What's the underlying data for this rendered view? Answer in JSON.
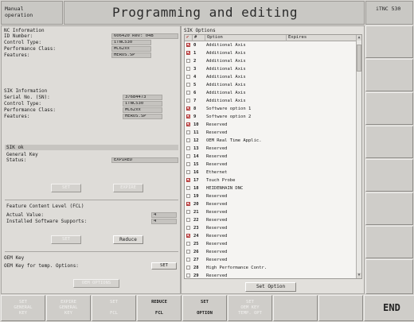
{
  "header": {
    "mode_line1": "Manual",
    "mode_line2": "operation",
    "title": "Programming and editing",
    "brand": "iTNC 530"
  },
  "nc_info": {
    "section_title": "NC Information",
    "rows": [
      {
        "label": "ID Number:",
        "value": "606420 Rev: 04B"
      },
      {
        "label": "Control Type:",
        "value": "iTNC530"
      },
      {
        "label": "Performance Class:",
        "value": "MC62xx"
      },
      {
        "label": "Features:",
        "value": "HEROS.SP"
      }
    ]
  },
  "sik_info": {
    "section_title": "SIK Information",
    "rows": [
      {
        "label": "Serial No. (SN):",
        "value": "37684473"
      },
      {
        "label": "Control Type:",
        "value": "iTNC530"
      },
      {
        "label": "Performance Class:",
        "value": "MC62xx"
      },
      {
        "label": "Features:",
        "value": "HEROS.SP"
      }
    ]
  },
  "sik_ok": {
    "bar_label": "SIK ok",
    "general_key_label": "General Key",
    "status_label": "Status:",
    "status_value": "EXPIRED",
    "btn_left": "SET",
    "btn_right": "EXPIRE"
  },
  "fcl": {
    "title": "Feature Content Level (FCL)",
    "actual_label": "Actual Value:",
    "actual_value": "4",
    "installed_label": "Installed Software Supports:",
    "installed_value": "4",
    "btn_set": "SET",
    "btn_reduce": "Reduce"
  },
  "oem": {
    "title": "OEM Key",
    "key_label": "OEM Key for temp. Options:",
    "key_button": "SET",
    "bottom_button": "OEM OPTIONS"
  },
  "sik_options": {
    "title": "SIK Options",
    "col_flag": "✔",
    "col_num": "#",
    "col_option": "Option",
    "col_expires": "Expires",
    "rows": [
      {
        "num": "0",
        "option": "Additional Axis",
        "checked": true
      },
      {
        "num": "1",
        "option": "Additional Axis",
        "checked": true
      },
      {
        "num": "2",
        "option": "Additional Axis",
        "checked": false
      },
      {
        "num": "3",
        "option": "Additional Axis",
        "checked": false
      },
      {
        "num": "4",
        "option": "Additional Axis",
        "checked": false
      },
      {
        "num": "5",
        "option": "Additional Axis",
        "checked": false
      },
      {
        "num": "6",
        "option": "Additional Axis",
        "checked": false
      },
      {
        "num": "7",
        "option": "Additional Axis",
        "checked": false
      },
      {
        "num": "8",
        "option": "Software option 1",
        "checked": true
      },
      {
        "num": "9",
        "option": "Software option 2",
        "checked": true
      },
      {
        "num": "10",
        "option": "Reserved",
        "checked": true
      },
      {
        "num": "11",
        "option": "Reserved",
        "checked": false
      },
      {
        "num": "12",
        "option": "OEM Real Time Applic.",
        "checked": false
      },
      {
        "num": "13",
        "option": "Reserved",
        "checked": false
      },
      {
        "num": "14",
        "option": "Reserved",
        "checked": false
      },
      {
        "num": "15",
        "option": "Reserved",
        "checked": false
      },
      {
        "num": "16",
        "option": "Ethernet",
        "checked": false
      },
      {
        "num": "17",
        "option": "Touch Probe",
        "checked": true
      },
      {
        "num": "18",
        "option": "HEIDENHAIN DNC",
        "checked": false
      },
      {
        "num": "19",
        "option": "Reserved",
        "checked": false
      },
      {
        "num": "20",
        "option": "Reserved",
        "checked": true
      },
      {
        "num": "21",
        "option": "Reserved",
        "checked": false
      },
      {
        "num": "22",
        "option": "Reserved",
        "checked": false
      },
      {
        "num": "23",
        "option": "Reserved",
        "checked": false
      },
      {
        "num": "24",
        "option": "Reserved",
        "checked": true
      },
      {
        "num": "25",
        "option": "Reserved",
        "checked": false
      },
      {
        "num": "26",
        "option": "Reserved",
        "checked": false
      },
      {
        "num": "27",
        "option": "Reserved",
        "checked": false
      },
      {
        "num": "28",
        "option": "High Performance Contr.",
        "checked": false
      },
      {
        "num": "29",
        "option": "Reserved",
        "checked": false
      }
    ],
    "set_option_button": "Set Option"
  },
  "softkeys": [
    {
      "label": "SET\nGENERAL\nKEY",
      "enabled": false
    },
    {
      "label": "EXPIRE\nGENERAL\nKEY",
      "enabled": false
    },
    {
      "label": "SET\n\nFCL",
      "enabled": false
    },
    {
      "label": "REDUCE\n\nFCL",
      "enabled": true
    },
    {
      "label": "SET\n\nOPTION",
      "enabled": true
    },
    {
      "label": "SET\nOEM KEY\nTEMP. OPT",
      "enabled": false
    },
    {
      "label": "",
      "enabled": false
    },
    {
      "label": "",
      "enabled": false
    },
    {
      "label": "END",
      "enabled": true
    }
  ]
}
